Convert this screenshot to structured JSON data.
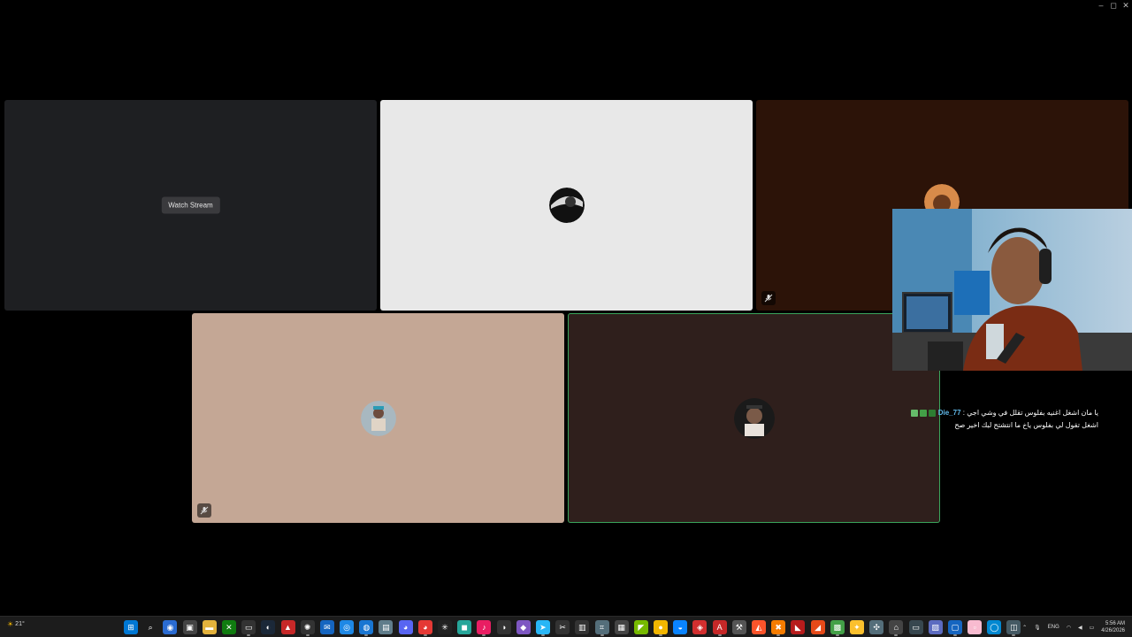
{
  "window": {
    "controls": [
      "–",
      "◻",
      "✕"
    ]
  },
  "stage": {
    "tiles": [
      {
        "id": "stream",
        "watch_label": "Watch Stream",
        "bg": "#1e1f22"
      },
      {
        "id": "user-white",
        "bg": "#e8e8e8"
      },
      {
        "id": "user-brown",
        "bg": "#2c1308",
        "muted": true
      },
      {
        "id": "user-tan",
        "bg": "#c4a795",
        "muted": true
      },
      {
        "id": "user-dark",
        "bg": "#2f1f1c",
        "speaking": true
      }
    ]
  },
  "chat": {
    "messages": [
      {
        "user": "Die_77",
        "separator": ":",
        "text": "يا مان اشغل اغنيه بفلوس تقلل في وشي اجي",
        "continuation": "اشغل تقول لي بفلوس ياخ ما انتشتح لبك اخير صح"
      }
    ]
  },
  "taskbar": {
    "weather": "21°",
    "icons": [
      {
        "name": "start-icon",
        "color": "#0078d4",
        "glyph": "⊞"
      },
      {
        "name": "search-icon",
        "color": "transparent",
        "glyph": "⌕"
      },
      {
        "name": "copilot-icon",
        "color": "#2a6bd1",
        "glyph": "◉"
      },
      {
        "name": "task-view-icon",
        "color": "#444",
        "glyph": "▣"
      },
      {
        "name": "file-explorer-icon",
        "color": "#e3b23c",
        "glyph": "▬"
      },
      {
        "name": "xbox-icon",
        "color": "#107c10",
        "glyph": "✕"
      },
      {
        "name": "terminal-icon",
        "color": "#333",
        "glyph": "▭"
      },
      {
        "name": "steam-icon",
        "color": "#1b2838",
        "glyph": "◐"
      },
      {
        "name": "game-app-icon",
        "color": "#c62828",
        "glyph": "▲"
      },
      {
        "name": "steelseries-icon",
        "color": "#333",
        "glyph": "✺"
      },
      {
        "name": "mail-icon",
        "color": "#1565c0",
        "glyph": "✉"
      },
      {
        "name": "browser-app-icon",
        "color": "#1e88e5",
        "glyph": "◎"
      },
      {
        "name": "edge-dev-icon",
        "color": "#1976d2",
        "glyph": "◍"
      },
      {
        "name": "notepad-icon",
        "color": "#607d8b",
        "glyph": "▤"
      },
      {
        "name": "discord-icon",
        "color": "#5865f2",
        "glyph": "◕"
      },
      {
        "name": "discord-canary-icon",
        "color": "#e53935",
        "glyph": "◕"
      },
      {
        "name": "react-devtools-icon",
        "color": "#222",
        "glyph": "✳"
      },
      {
        "name": "app-green-icon",
        "color": "#26a69a",
        "glyph": "◼"
      },
      {
        "name": "tiktok-icon",
        "color": "#e91e63",
        "glyph": "♪"
      },
      {
        "name": "obs-icon",
        "color": "#333",
        "glyph": "◑"
      },
      {
        "name": "dev-app-icon",
        "color": "#7e57c2",
        "glyph": "◆"
      },
      {
        "name": "telegram-icon",
        "color": "#29b6f6",
        "glyph": "➤"
      },
      {
        "name": "capcut-icon",
        "color": "#333",
        "glyph": "✂"
      },
      {
        "name": "code-icon",
        "color": "#333",
        "glyph": "▥"
      },
      {
        "name": "network-app-icon",
        "color": "#546e7a",
        "glyph": "⌗"
      },
      {
        "name": "photos-icon",
        "color": "#444",
        "glyph": "▦"
      },
      {
        "name": "nvidia-icon",
        "color": "#76b900",
        "glyph": "◤"
      },
      {
        "name": "chrome-icon",
        "color": "#f2b600",
        "glyph": "●"
      },
      {
        "name": "edge-icon",
        "color": "#0a84ff",
        "glyph": "◒"
      },
      {
        "name": "riot-icon",
        "color": "#d32f2f",
        "glyph": "◈"
      },
      {
        "name": "adobe-icon",
        "color": "#c62828",
        "glyph": "A"
      },
      {
        "name": "tools-icon",
        "color": "#555",
        "glyph": "⚒"
      },
      {
        "name": "brave-icon",
        "color": "#fb542b",
        "glyph": "◭"
      },
      {
        "name": "blender-icon",
        "color": "#f57c00",
        "glyph": "✖"
      },
      {
        "name": "game-red-icon",
        "color": "#b71c1c",
        "glyph": "◣"
      },
      {
        "name": "game-orange-icon",
        "color": "#e64a19",
        "glyph": "◢"
      },
      {
        "name": "grid-app-icon",
        "color": "#43a047",
        "glyph": "▩"
      },
      {
        "name": "badge-app-icon",
        "color": "#fbc02d",
        "glyph": "✦"
      },
      {
        "name": "ai-app-icon",
        "color": "#546e7a",
        "glyph": "✣"
      },
      {
        "name": "home-icon",
        "color": "#444",
        "glyph": "⌂"
      },
      {
        "name": "remote-desktop-icon",
        "color": "#37474f",
        "glyph": "▭"
      },
      {
        "name": "photo-viewer-icon",
        "color": "#5c6bc0",
        "glyph": "▨"
      },
      {
        "name": "window-app-icon",
        "color": "#1565c0",
        "glyph": "▢"
      },
      {
        "name": "pink-app-icon",
        "color": "#f8bbd0",
        "glyph": "▫"
      },
      {
        "name": "globe-icon",
        "color": "#0288d1",
        "glyph": "◯"
      },
      {
        "name": "capture-app-icon",
        "color": "#455a64",
        "glyph": "◫"
      }
    ],
    "tray": {
      "chevron": "⌃",
      "language": "ENG",
      "time": "5:56 AM",
      "date": "4/26/2026"
    }
  }
}
